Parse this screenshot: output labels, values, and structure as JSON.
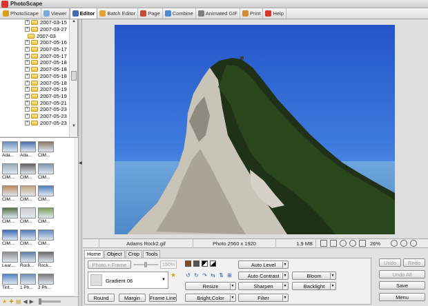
{
  "window": {
    "title": "PhotoScape"
  },
  "tabs": [
    {
      "label": "PhotoScape",
      "color": "#d9a01b",
      "active": false
    },
    {
      "label": "Viewer",
      "color": "#7fa8d8",
      "active": false
    },
    {
      "label": "Editor",
      "color": "#3d6fb6",
      "active": true
    },
    {
      "label": "Batch Editor",
      "color": "#e2a236",
      "active": false
    },
    {
      "label": "Page",
      "color": "#c64a3a",
      "active": false
    },
    {
      "label": "Combine",
      "color": "#4d8bd0",
      "active": false
    },
    {
      "label": "Animated GIF",
      "color": "#7e7e7e",
      "active": false
    },
    {
      "label": "Print",
      "color": "#d58c2f",
      "active": false
    },
    {
      "label": "Help",
      "color": "#d33a2a",
      "active": false
    }
  ],
  "tree": {
    "folders": [
      {
        "label": "2007-03-15",
        "indent": 1
      },
      {
        "label": "2007-03-27",
        "indent": 1
      },
      {
        "label": "2007-03",
        "indent": 2
      },
      {
        "label": "2007-05-16",
        "indent": 1
      },
      {
        "label": "2007-05-17",
        "indent": 1
      },
      {
        "label": "2007-05-17",
        "indent": 1
      },
      {
        "label": "2007-05-18",
        "indent": 1
      },
      {
        "label": "2007-05-18",
        "indent": 1
      },
      {
        "label": "2007-05-18",
        "indent": 1
      },
      {
        "label": "2007-05-18",
        "indent": 1
      },
      {
        "label": "2007-05-19",
        "indent": 1
      },
      {
        "label": "2007-05-19",
        "indent": 1
      },
      {
        "label": "2007-05-21",
        "indent": 1
      },
      {
        "label": "2007-05-23",
        "indent": 1
      },
      {
        "label": "2007-05-23",
        "indent": 1
      },
      {
        "label": "2007-05-23",
        "indent": 1
      }
    ]
  },
  "thumbnails": [
    {
      "caption": "Ada...",
      "color": "#6b8dbb"
    },
    {
      "caption": "Ada...",
      "color": "#4a6fb0"
    },
    {
      "caption": "CIM...",
      "color": "#8a7a6a"
    },
    {
      "caption": "CIM...",
      "color": "#9aa8b5"
    },
    {
      "caption": "CIM...",
      "color": "#5f5f5f"
    },
    {
      "caption": "CIM...",
      "color": "#7f96ab"
    },
    {
      "caption": "CIM...",
      "color": "#b98b5a"
    },
    {
      "caption": "CIM...",
      "color": "#c7a47f"
    },
    {
      "caption": "CIM...",
      "color": "#4f7fb8"
    },
    {
      "caption": "CIM...",
      "color": "#556e4a"
    },
    {
      "caption": "CIM...",
      "color": "#d0d0d0"
    },
    {
      "caption": "CIM...",
      "color": "#7fa05a"
    },
    {
      "caption": "CIM...",
      "color": "#3b6bb5"
    },
    {
      "caption": "CIM...",
      "color": "#4f78b8"
    },
    {
      "caption": "CIM...",
      "color": "#6289c0"
    },
    {
      "caption": "Lear...",
      "color": "#8d8d8d"
    },
    {
      "caption": "Rock...",
      "color": "#5e7fa6"
    },
    {
      "caption": "Rock...",
      "color": "#6a6a6a"
    },
    {
      "caption": "Tint...",
      "color": "#4e86c6"
    },
    {
      "caption": "1 Ph...",
      "color": "#6e8fb6"
    },
    {
      "caption": "2 Ph...",
      "color": "#7a7a7a"
    }
  ],
  "status": {
    "filename": "Adams Rock2.gif",
    "dimensions": "Photo 2560 x 1920",
    "filesize": "1.9 MB",
    "zoom": "26%"
  },
  "panel": {
    "tabs": [
      "Home",
      "Object",
      "Crop",
      "Tools"
    ],
    "photo_frame": "Photo + Frame",
    "zoom_value": "150%",
    "gradient": "Gradient 06",
    "round": "Round",
    "margin": "Margin",
    "frame_line": "Frame Line",
    "resize": "Resize",
    "bright_color": "Bright,Color",
    "auto_level": "Auto Level",
    "auto_contrast": "Auto Contrast",
    "sharpen": "Sharpen",
    "filter": "Filter",
    "bloom": "Bloom",
    "backlight": "Backlight"
  },
  "right_buttons": {
    "undo": "Undo",
    "redo": "Redo",
    "undo_all": "Undo All",
    "save": "Save",
    "menu": "Menu"
  }
}
